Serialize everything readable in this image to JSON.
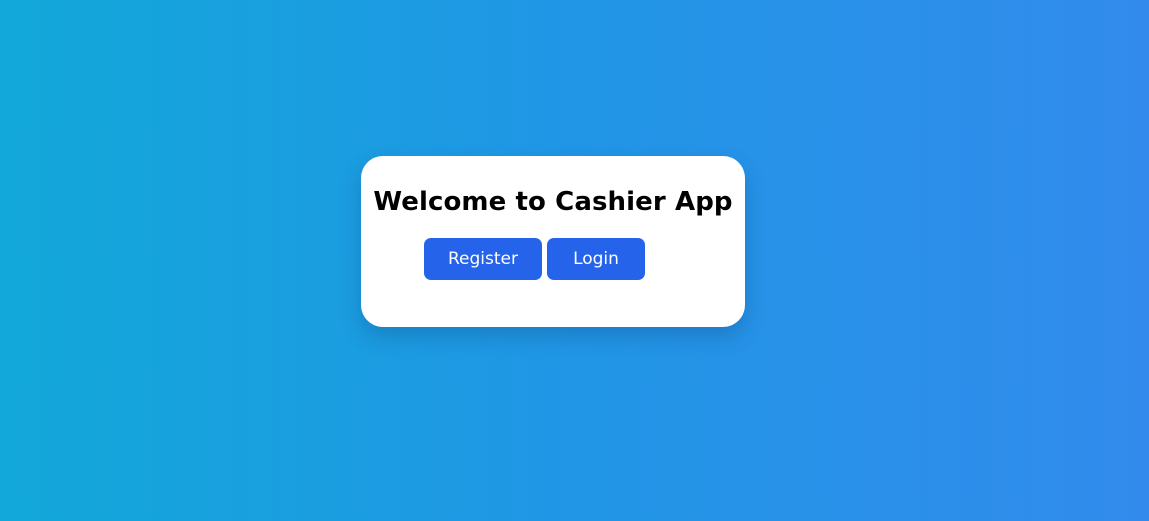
{
  "welcome": {
    "title": "Welcome to Cashier App",
    "register_label": "Register",
    "login_label": "Login"
  },
  "colors": {
    "background_start": "#12a8d9",
    "background_end": "#328bec",
    "card": "#ffffff",
    "button": "#2563eb",
    "button_text": "#ffffff"
  }
}
